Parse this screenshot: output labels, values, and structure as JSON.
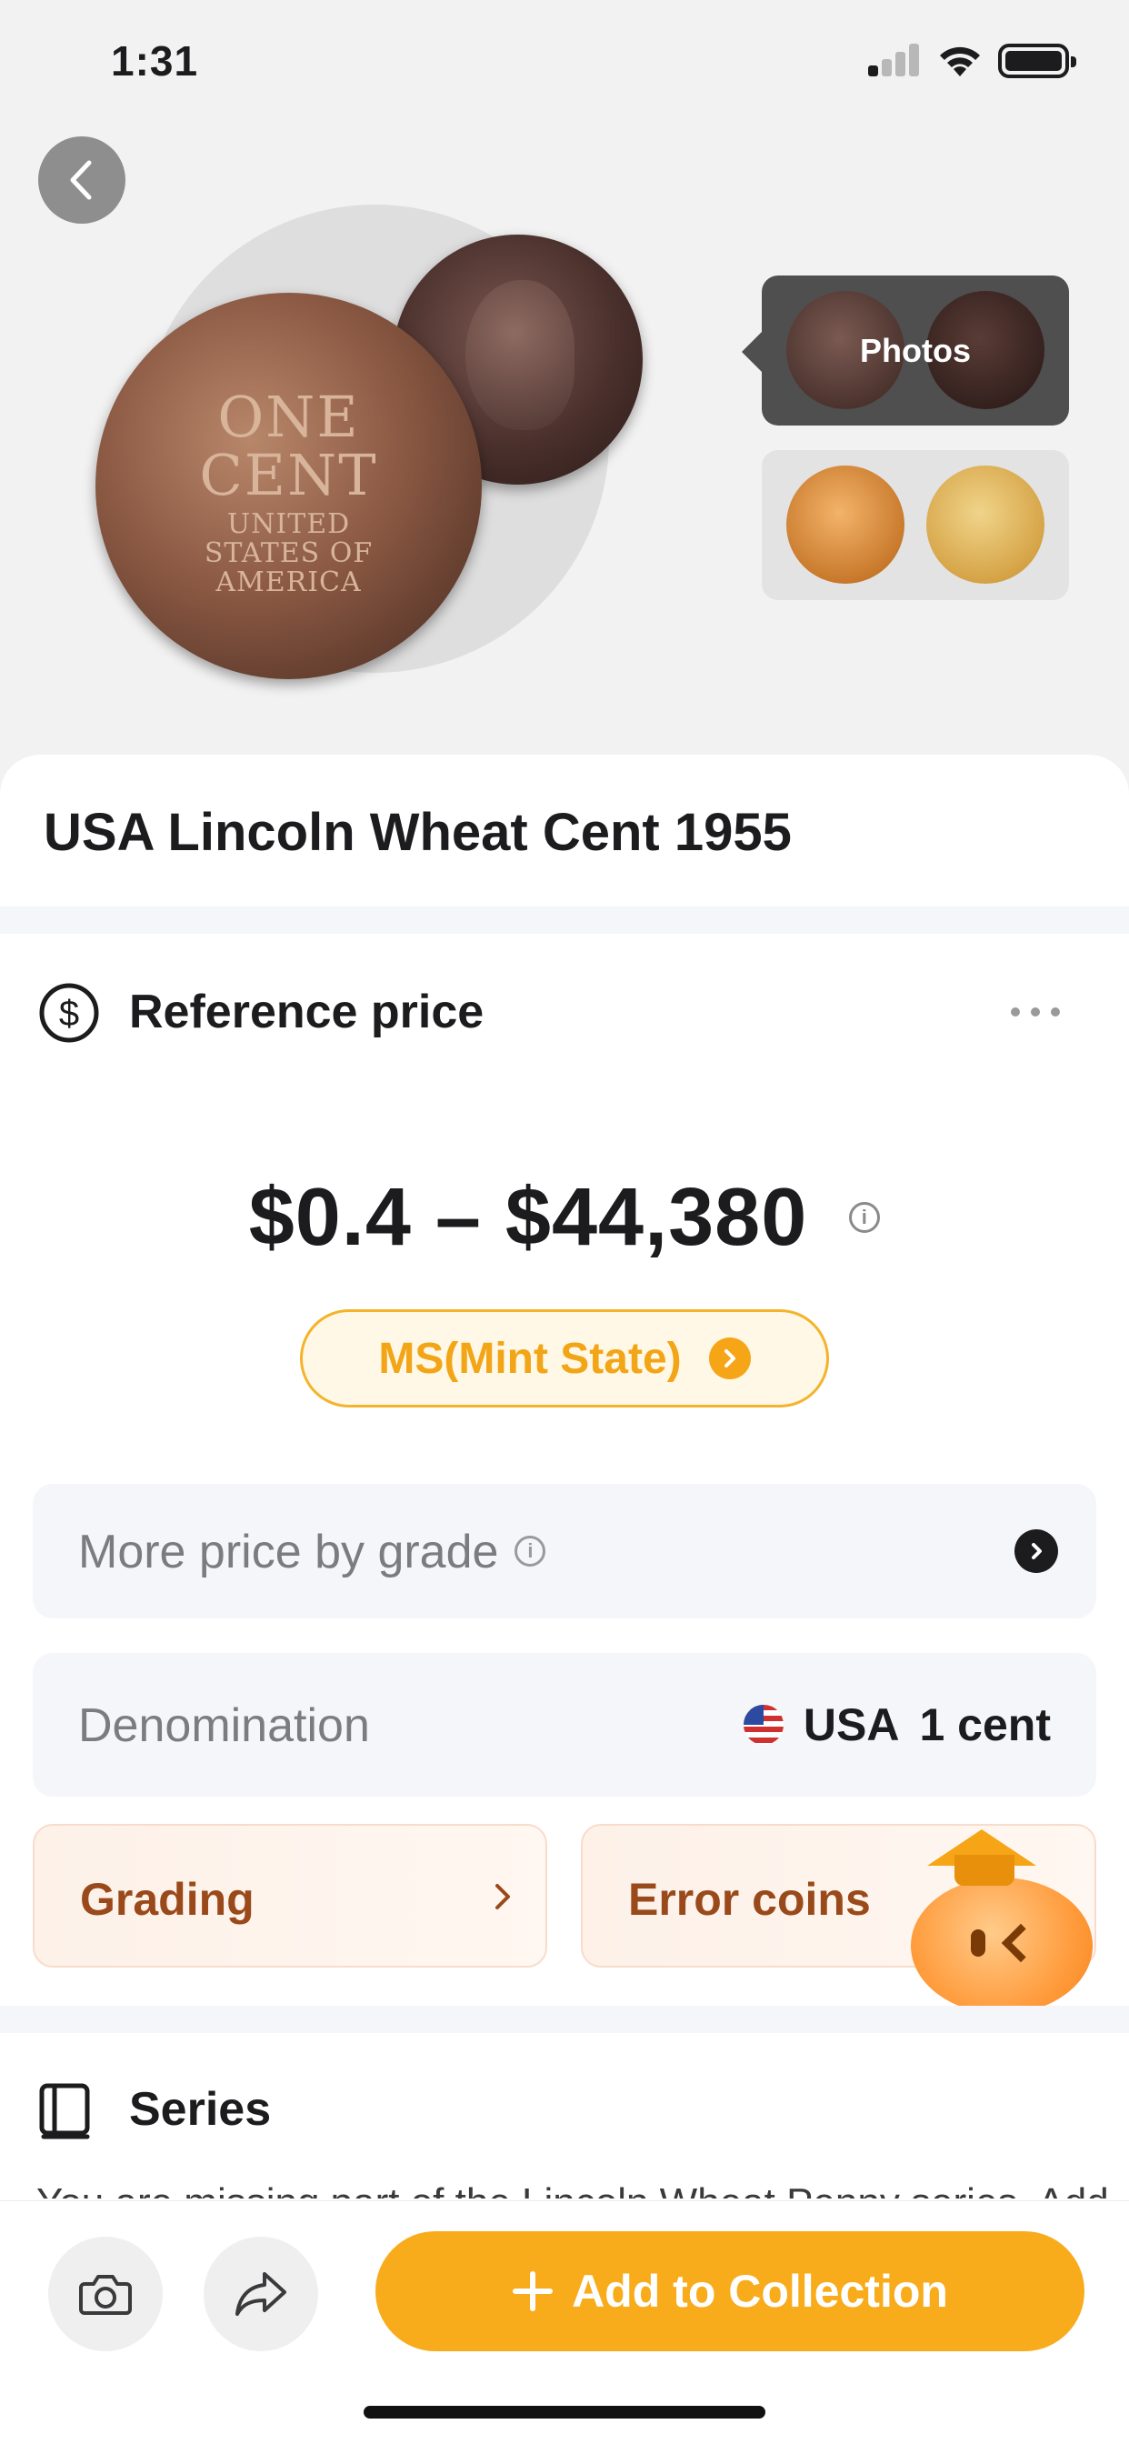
{
  "status_bar": {
    "time": "1:31"
  },
  "hero": {
    "coin_front_text": "ONE CENT",
    "coin_front_small": "UNITED STATES OF AMERICA",
    "photos_label": "Photos"
  },
  "coin": {
    "title": "USA Lincoln Wheat Cent 1955"
  },
  "reference_price": {
    "heading": "Reference price",
    "price_range": "$0.4 – $44,380",
    "grade_label": "MS(Mint State)"
  },
  "rows": {
    "more_price_label": "More price by grade",
    "denomination_label": "Denomination",
    "denomination_country": "USA",
    "denomination_value": "1 cent"
  },
  "tiles": {
    "grading": "Grading",
    "error_coins": "Error coins"
  },
  "series": {
    "heading": "Series",
    "peek_text": "You are missing part of the Lincoln Wheat Penny series. Add"
  },
  "bottom": {
    "add_label": "Add to Collection"
  },
  "colors": {
    "accent": "#F8AC1C",
    "grade_text": "#F2A516",
    "tile_text": "#9A4A1A"
  },
  "icons": [
    "chevron-left-icon",
    "dollar-circle-icon",
    "more-dots-icon",
    "info-icon",
    "chevron-right-icon",
    "us-flag-icon",
    "book-icon",
    "camera-icon",
    "share-icon",
    "plus-icon",
    "mascot-icon"
  ]
}
